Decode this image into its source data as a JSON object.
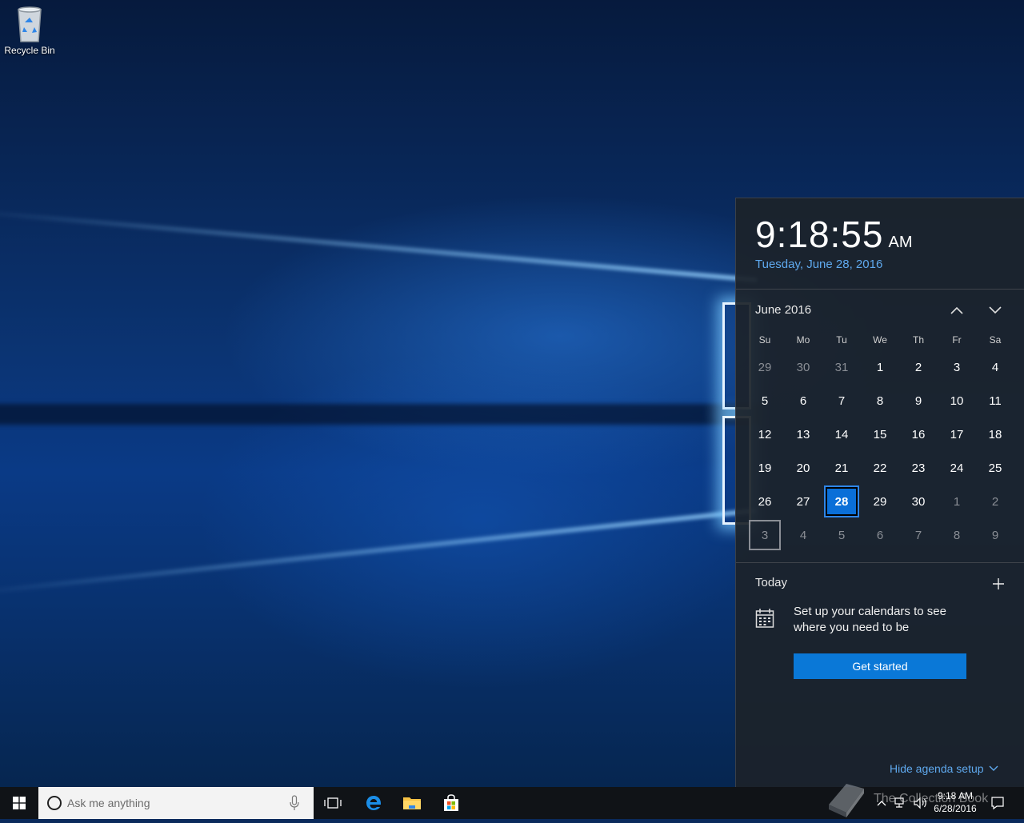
{
  "desktop": {
    "icons": [
      {
        "label": "Recycle Bin",
        "icon": "recycle-bin-icon"
      }
    ]
  },
  "flyout": {
    "time": "9:18:55",
    "ampm": "AM",
    "date_long": "Tuesday, June 28, 2016",
    "month_label": "June 2016",
    "weekdays": [
      "Su",
      "Mo",
      "Tu",
      "We",
      "Th",
      "Fr",
      "Sa"
    ],
    "weeks": [
      [
        "29",
        "30",
        "31",
        "1",
        "2",
        "3",
        "4"
      ],
      [
        "5",
        "6",
        "7",
        "8",
        "9",
        "10",
        "11"
      ],
      [
        "12",
        "13",
        "14",
        "15",
        "16",
        "17",
        "18"
      ],
      [
        "19",
        "20",
        "21",
        "22",
        "23",
        "24",
        "25"
      ],
      [
        "26",
        "27",
        "28",
        "29",
        "30",
        "1",
        "2"
      ],
      [
        "3",
        "4",
        "5",
        "6",
        "7",
        "8",
        "9"
      ]
    ],
    "agenda": {
      "title": "Today",
      "message": "Set up your calendars to see where you need to be",
      "button": "Get started",
      "hide_link": "Hide agenda setup"
    },
    "accent_color": "#0a78d7",
    "link_color": "#5fa9ee"
  },
  "taskbar": {
    "search_placeholder": "Ask me anything",
    "pinned": [
      "task-view-icon",
      "edge-icon",
      "file-explorer-icon",
      "store-icon"
    ],
    "clock_time": "9:18 AM",
    "clock_date": "6/28/2016"
  },
  "watermark": {
    "text": "The Collection Book"
  }
}
